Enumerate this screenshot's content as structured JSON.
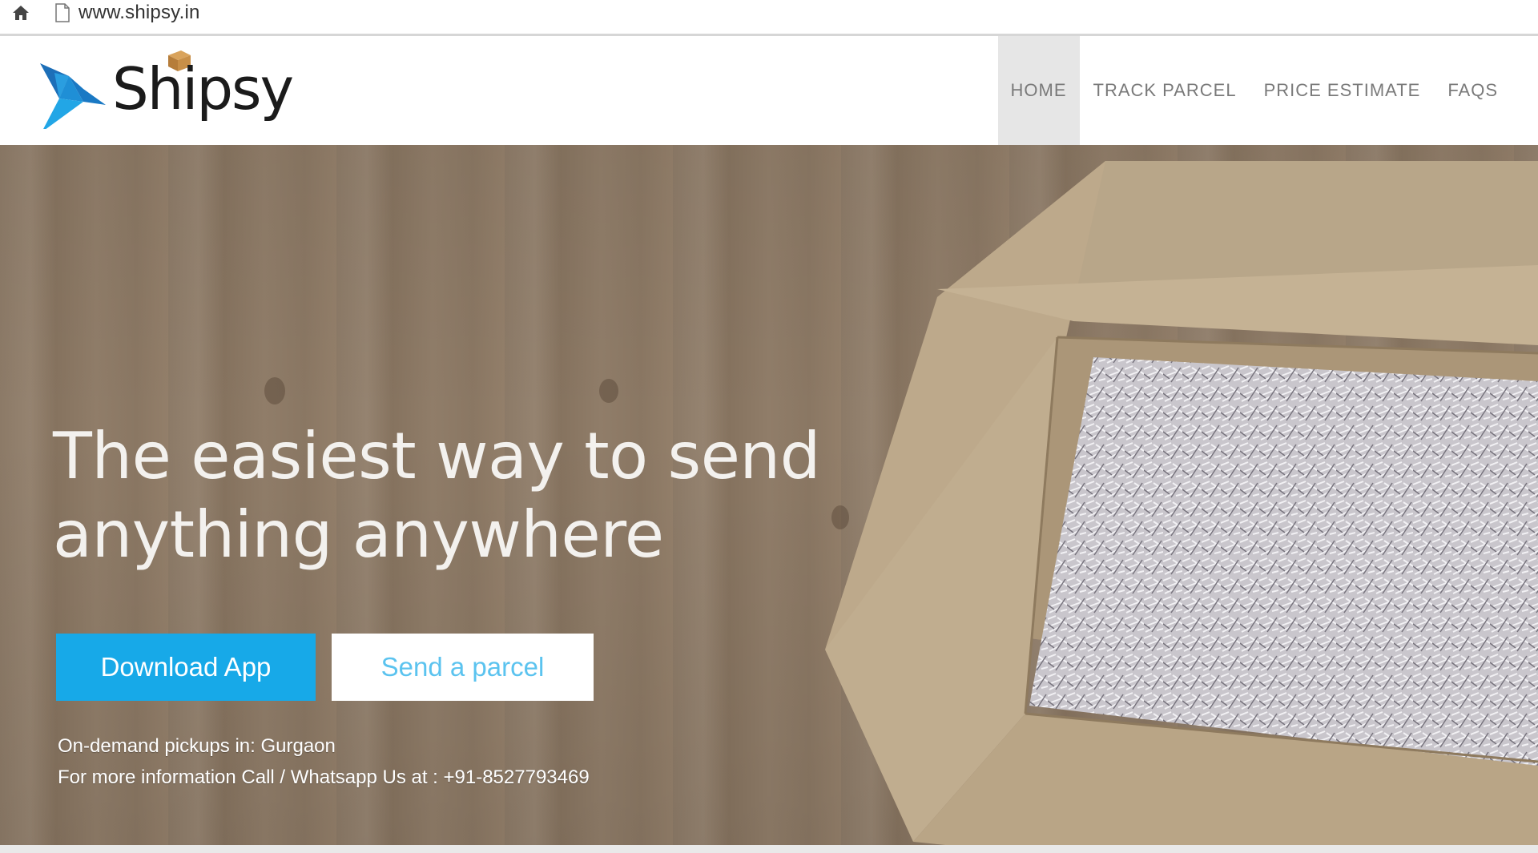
{
  "browser": {
    "url": "www.shipsy.in",
    "home_icon": "home-icon",
    "page_icon": "page-icon"
  },
  "header": {
    "logo_text": "Shipsy",
    "logo_icon": "bird-logo-icon",
    "nav": [
      {
        "label": "HOME",
        "active": true
      },
      {
        "label": "TRACK PARCEL",
        "active": false
      },
      {
        "label": "PRICE ESTIMATE",
        "active": false
      },
      {
        "label": "FAQS",
        "active": false
      }
    ]
  },
  "hero": {
    "headline_line1": "The easiest way to send",
    "headline_line2": "anything anywhere",
    "download_button": "Download App",
    "send_button": "Send a parcel",
    "pickup_text": "On-demand pickups in: Gurgaon",
    "contact_text": "For more information Call / Whatsapp Us at : +91-8527793469"
  },
  "colors": {
    "brand_blue": "#17a9e8",
    "nav_text": "#7a7a7a",
    "active_nav_bg": "#e6e6e6",
    "wood": "#8c7a67"
  }
}
